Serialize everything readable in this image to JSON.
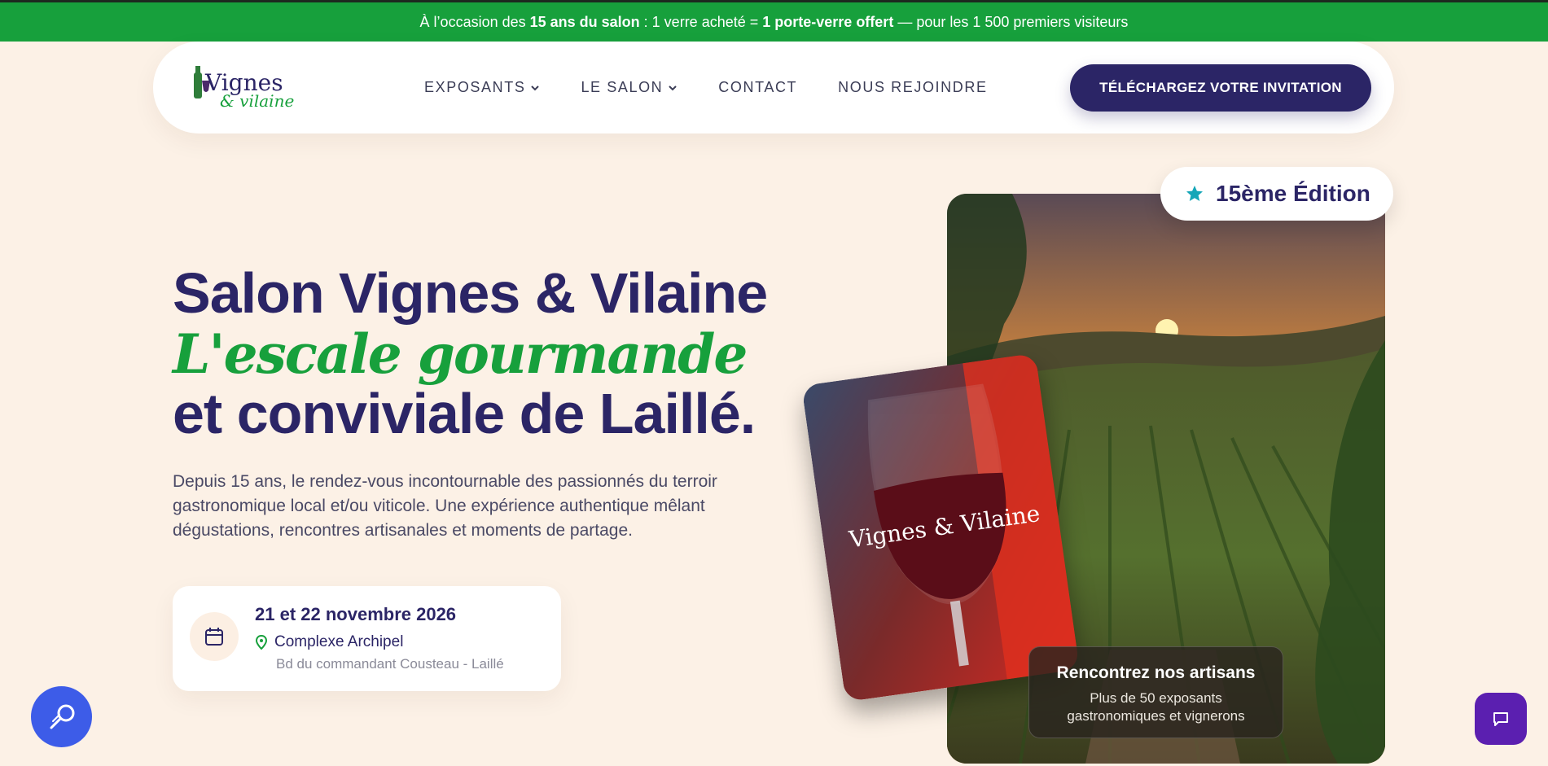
{
  "banner": {
    "prefix": "À l’occasion des ",
    "bold1": "15 ans du salon",
    "middle": " : 1 verre acheté = ",
    "bold2": "1 porte-verre offert",
    "suffix": " — pour les 1 500 premiers visiteurs"
  },
  "header": {
    "logo_text": "Vignes & Vilaine",
    "menu": [
      {
        "label": "EXPOSANTS",
        "dropdown": true
      },
      {
        "label": "LE SALON",
        "dropdown": true
      },
      {
        "label": "CONTACT",
        "dropdown": false
      },
      {
        "label": "NOUS REJOINDRE",
        "dropdown": false
      }
    ],
    "cta_label": "TÉLÉCHARGEZ VOTRE INVITATION"
  },
  "hero": {
    "title_line1": "Salon Vignes & Vilaine",
    "title_line2": "L'escale gourmande",
    "title_line3": "et conviviale de Laillé.",
    "description": "Depuis 15 ans, le rendez-vous incontournable des passionnés du terroir gastronomique local et/ou viticole. Une expérience authentique mêlant dégustations, rencontres artisanales et moments de partage.",
    "event": {
      "date": "21 et 22 novembre 2026",
      "place": "Complexe Archipel",
      "address": "Bd du commandant Cousteau - Laillé"
    }
  },
  "media": {
    "edition_badge": "15ème Édition",
    "glass_logo": "Vignes & Vilaine",
    "artisans_title": "Rencontrez nos artisans",
    "artisans_sub_line1": "Plus de 50 exposants",
    "artisans_sub_line2": "gastronomiques et vignerons"
  },
  "colors": {
    "brand_green": "#17a03c",
    "brand_navy": "#2b2566",
    "background": "#fcf1e6",
    "accessibility_blue": "#3d5ce8",
    "chat_purple": "#5b1fb0"
  },
  "icons": [
    "chevron-down-icon",
    "calendar-icon",
    "location-pin-icon",
    "star-icon",
    "accessibility-icon",
    "chat-icon"
  ]
}
